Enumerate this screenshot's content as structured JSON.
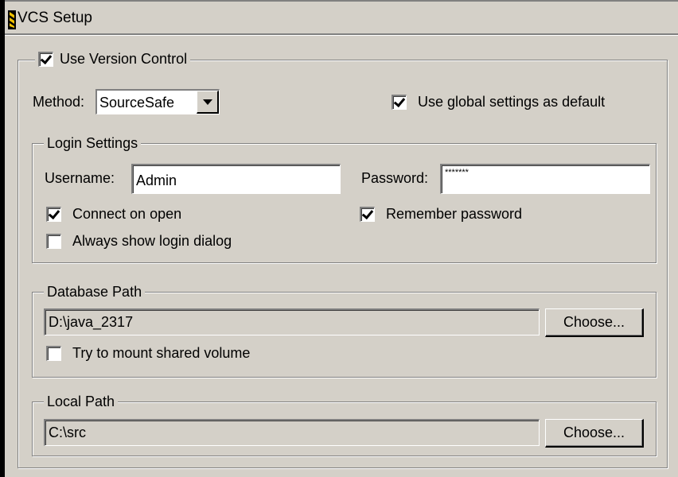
{
  "window": {
    "title": "VCS Setup"
  },
  "use_version_control": {
    "label": "Use Version Control",
    "checked": true
  },
  "method": {
    "label": "Method:",
    "selected": "SourceSafe"
  },
  "use_global_settings": {
    "label": "Use global settings as default",
    "checked": true
  },
  "login_settings": {
    "legend": "Login Settings",
    "username_label": "Username:",
    "username_value": "Admin",
    "password_label": "Password:",
    "password_value": "*******",
    "connect_on_open": {
      "label": "Connect on open",
      "checked": true
    },
    "remember_password": {
      "label": "Remember password",
      "checked": true
    },
    "always_show_login": {
      "label": "Always show login dialog",
      "checked": false
    }
  },
  "database_path": {
    "legend": "Database Path",
    "value": "D:\\java_2317",
    "choose_label": "Choose...",
    "mount_shared": {
      "label": "Try to mount shared volume",
      "checked": false
    }
  },
  "local_path": {
    "legend": "Local Path",
    "value": "C:\\src",
    "choose_label": "Choose..."
  },
  "colors": {
    "face": "#d4d0c8",
    "shadow": "#808080",
    "highlight": "#ffffff"
  }
}
